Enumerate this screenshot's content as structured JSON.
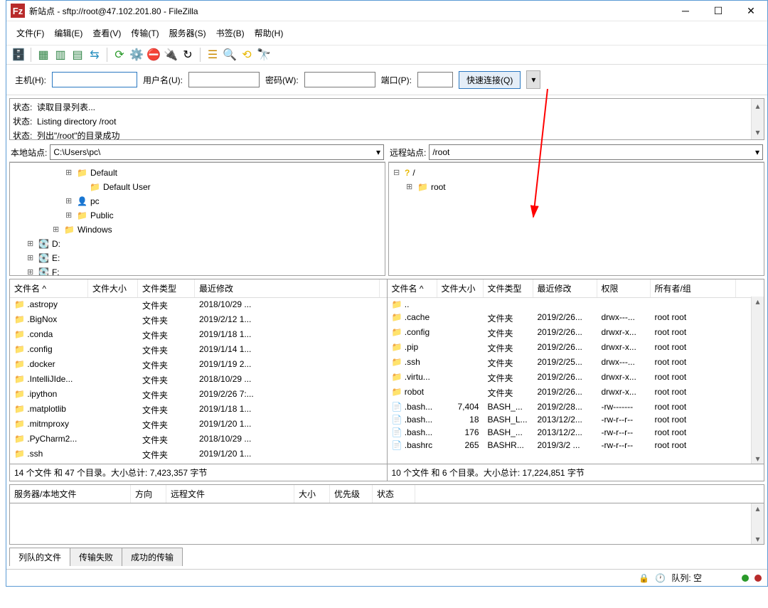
{
  "title": "新站点 - sftp://root@47.102.201.80 - FileZilla",
  "app_icon": "Fz",
  "menu": [
    "文件(F)",
    "编辑(E)",
    "查看(V)",
    "传输(T)",
    "服务器(S)",
    "书签(B)",
    "帮助(H)"
  ],
  "quick": {
    "host_label": "主机(H):",
    "host": "",
    "user_label": "用户名(U):",
    "user": "",
    "pass_label": "密码(W):",
    "pass": "",
    "port_label": "端口(P):",
    "port": "",
    "connect": "快速连接(Q)"
  },
  "log": [
    {
      "k": "状态:",
      "v": "读取目录列表..."
    },
    {
      "k": "状态:",
      "v": "Listing directory /root"
    },
    {
      "k": "状态:",
      "v": "列出\"/root\"的目录成功"
    }
  ],
  "local": {
    "label": "本地站点:",
    "path": "C:\\Users\\pc\\",
    "tree": [
      {
        "indent": 4,
        "exp": "⊞",
        "ico": "📁",
        "name": "Default"
      },
      {
        "indent": 5,
        "exp": "",
        "ico": "📁",
        "name": "Default User"
      },
      {
        "indent": 4,
        "exp": "⊞",
        "ico": "👤",
        "name": "pc"
      },
      {
        "indent": 4,
        "exp": "⊞",
        "ico": "📁",
        "name": "Public"
      },
      {
        "indent": 3,
        "exp": "⊞",
        "ico": "📁",
        "name": "Windows"
      },
      {
        "indent": 1,
        "exp": "⊞",
        "ico": "💽",
        "name": "D:"
      },
      {
        "indent": 1,
        "exp": "⊞",
        "ico": "💽",
        "name": "E:"
      },
      {
        "indent": 1,
        "exp": "⊞",
        "ico": "💽",
        "name": "F:"
      }
    ],
    "cols": [
      "文件名 ^",
      "文件大小",
      "文件类型",
      "最近修改"
    ],
    "rows": [
      [
        "📁 .astropy",
        "",
        "文件夹",
        "2018/10/29 ..."
      ],
      [
        "📁 .BigNox",
        "",
        "文件夹",
        "2019/2/12 1..."
      ],
      [
        "📁 .conda",
        "",
        "文件夹",
        "2019/1/18 1..."
      ],
      [
        "📁 .config",
        "",
        "文件夹",
        "2019/1/14 1..."
      ],
      [
        "📁 .docker",
        "",
        "文件夹",
        "2019/1/19 2..."
      ],
      [
        "📁 .IntelliJIde...",
        "",
        "文件夹",
        "2018/10/29 ..."
      ],
      [
        "📁 .ipython",
        "",
        "文件夹",
        "2019/2/26 7:..."
      ],
      [
        "📁 .matplotlib",
        "",
        "文件夹",
        "2019/1/18 1..."
      ],
      [
        "📁 .mitmproxy",
        "",
        "文件夹",
        "2019/1/20 1..."
      ],
      [
        "📁 .PyCharm2...",
        "",
        "文件夹",
        "2018/10/29 ..."
      ],
      [
        "📁 .ssh",
        "",
        "文件夹",
        "2019/1/20 1..."
      ]
    ],
    "summary": "14 个文件 和 47 个目录。大小总计: 7,423,357 字节"
  },
  "remote": {
    "label": "远程站点:",
    "path": "/root",
    "tree": [
      {
        "indent": 0,
        "exp": "⊟",
        "ico": "?",
        "name": "/"
      },
      {
        "indent": 1,
        "exp": "⊞",
        "ico": "📁",
        "name": "root"
      }
    ],
    "cols": [
      "文件名 ^",
      "文件大小",
      "文件类型",
      "最近修改",
      "权限",
      "所有者/组"
    ],
    "rows": [
      [
        "📁 ..",
        "",
        "",
        "",
        "",
        ""
      ],
      [
        "📁 .cache",
        "",
        "文件夹",
        "2019/2/26...",
        "drwx---...",
        "root root"
      ],
      [
        "📁 .config",
        "",
        "文件夹",
        "2019/2/26...",
        "drwxr-x...",
        "root root"
      ],
      [
        "📁 .pip",
        "",
        "文件夹",
        "2019/2/26...",
        "drwxr-x...",
        "root root"
      ],
      [
        "📁 .ssh",
        "",
        "文件夹",
        "2019/2/25...",
        "drwx---...",
        "root root"
      ],
      [
        "📁 .virtu...",
        "",
        "文件夹",
        "2019/2/26...",
        "drwxr-x...",
        "root root"
      ],
      [
        "📁 robot",
        "",
        "文件夹",
        "2019/2/26...",
        "drwxr-x...",
        "root root"
      ],
      [
        "📄 .bash...",
        "7,404",
        "BASH_...",
        "2019/2/28...",
        "-rw-------",
        "root root"
      ],
      [
        "📄 .bash...",
        "18",
        "BASH_L...",
        "2013/12/2...",
        "-rw-r--r--",
        "root root"
      ],
      [
        "📄 .bash...",
        "176",
        "BASH_...",
        "2013/12/2...",
        "-rw-r--r--",
        "root root"
      ],
      [
        "📄 .bashrc",
        "265",
        "BASHR...",
        "2019/3/2 ...",
        "-rw-r--r--",
        "root root"
      ]
    ],
    "summary": "10 个文件 和 6 个目录。大小总计: 17,224,851 字节"
  },
  "queue_cols": [
    "服务器/本地文件",
    "方向",
    "远程文件",
    "大小",
    "优先级",
    "状态"
  ],
  "tabs": [
    "列队的文件",
    "传输失败",
    "成功的传输"
  ],
  "status": {
    "queue_label": "队列: 空"
  }
}
